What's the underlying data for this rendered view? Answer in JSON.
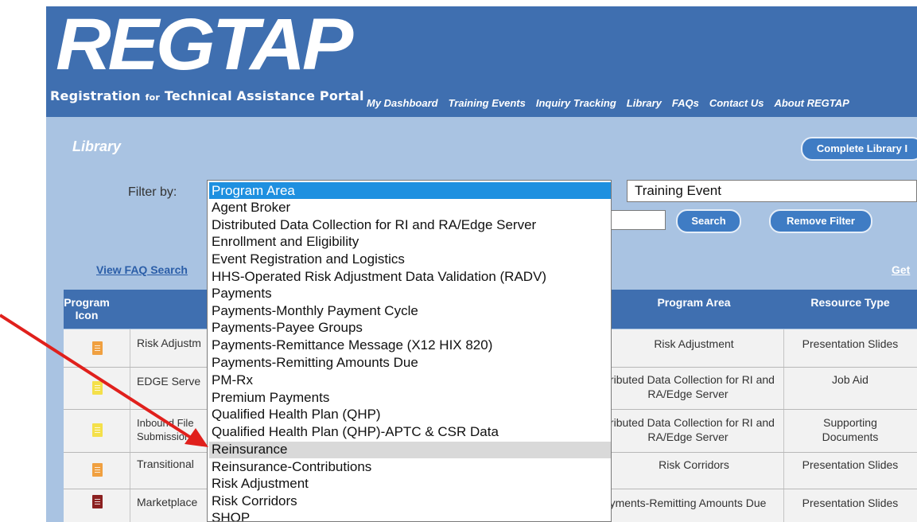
{
  "header": {
    "logo_text": "REGTAP",
    "subtitle_main_1": "Registration",
    "subtitle_small": "for",
    "subtitle_main_2": "Technical Assistance Portal",
    "nav": [
      "My Dashboard",
      "Training Events",
      "Inquiry Tracking",
      "Library",
      "FAQs",
      "Contact Us",
      "About REGTAP"
    ]
  },
  "library": {
    "title": "Library",
    "complete_library_button": "Complete Library I",
    "filter_label": "Filter by:",
    "program_area_select": {
      "selected": "Program Area",
      "options": [
        "Agent Broker",
        "Distributed Data Collection for RI and RA/Edge Server",
        "Enrollment and Eligibility",
        "Event Registration and Logistics",
        "HHS-Operated Risk Adjustment Data Validation (RADV)",
        "Payments",
        "Payments-Monthly Payment Cycle",
        "Payments-Payee Groups",
        "Payments-Remittance Message (X12 HIX 820)",
        "Payments-Remitting Amounts Due",
        "PM-Rx",
        "Premium Payments",
        "Qualified Health Plan (QHP)",
        "Qualified Health Plan (QHP)-APTC & CSR Data",
        "Reinsurance",
        "Reinsurance-Contributions",
        "Risk Adjustment",
        "Risk Corridors",
        "SHOP"
      ],
      "hovered": "Reinsurance"
    },
    "event_select_value": "Training Event",
    "search_button": "Search",
    "remove_filter_button": "Remove Filter",
    "view_faq_link": "View FAQ Search",
    "get_link": "Get"
  },
  "table": {
    "headers": {
      "icon": "Program Icon",
      "program_area": "Program Area",
      "resource_type": "Resource Type"
    },
    "rows": [
      {
        "icon_color": "#f0a040",
        "title": "Risk Adjustm",
        "program_area": "Risk Adjustment",
        "resource_type": "Presentation Slides"
      },
      {
        "icon_color": "#f4e04a",
        "title": "EDGE Serve",
        "program_area": "stributed Data Collection for RI and RA/Edge Server",
        "resource_type": "Job Aid"
      },
      {
        "icon_color": "#f4e04a",
        "title_line1": "Inbound File",
        "title_line2": "Submission",
        "program_area": "stributed Data Collection for RI and RA/Edge Server",
        "resource_type": "Supporting Documents"
      },
      {
        "icon_color": "#f0a040",
        "title": "Transitional",
        "program_area": "Risk Corridors",
        "resource_type": "Presentation Slides"
      },
      {
        "icon_color": "#8b2020",
        "title": "Marketplace",
        "program_area": "yments-Remitting Amounts Due",
        "resource_type": "Presentation Slides"
      }
    ]
  },
  "colors": {
    "header_blue": "#3f6fb0",
    "band_blue": "#a9c3e2",
    "selection_blue": "#1e90e0",
    "arrow_red": "#e0201c"
  }
}
